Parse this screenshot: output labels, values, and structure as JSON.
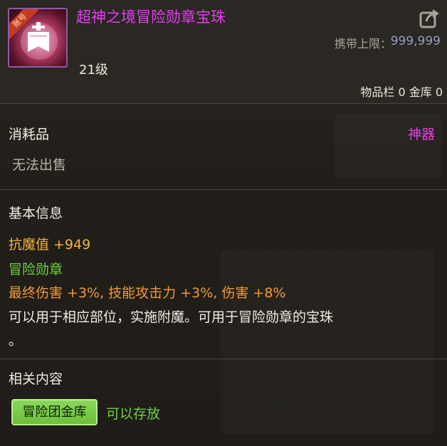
{
  "item": {
    "title": "超神之境冒险勋章宝珠",
    "icon_badge": "账号",
    "carry_label": "携带上限：",
    "carry_value": "999,999",
    "level": "21级",
    "storage": "物品栏 0 金库 0"
  },
  "category": {
    "type": "消耗品",
    "rarity": "神器",
    "sell_status": "无法出售"
  },
  "basic_info": {
    "heading": "基本信息",
    "stat": "抗魔值 +949",
    "slot": "冒险勋章",
    "bonus": "最终伤害 +3%, 技能攻击力 +3%, 伤害 +8%",
    "desc_line1": "可以用于相应部位，实施附魔。可用于冒险勋章的宝珠",
    "desc_line2": "。"
  },
  "related": {
    "heading": "相关内容",
    "badge": "冒险团金库",
    "status": "可以存放"
  },
  "icons": {
    "share": "share-export-icon",
    "item": "medal-orb-icon"
  },
  "colors": {
    "title": "#e43cf3",
    "rarity": "#e83fe6",
    "stat": "#f0b43f",
    "slot": "#6fd13c",
    "bonus": "#f09a35"
  }
}
